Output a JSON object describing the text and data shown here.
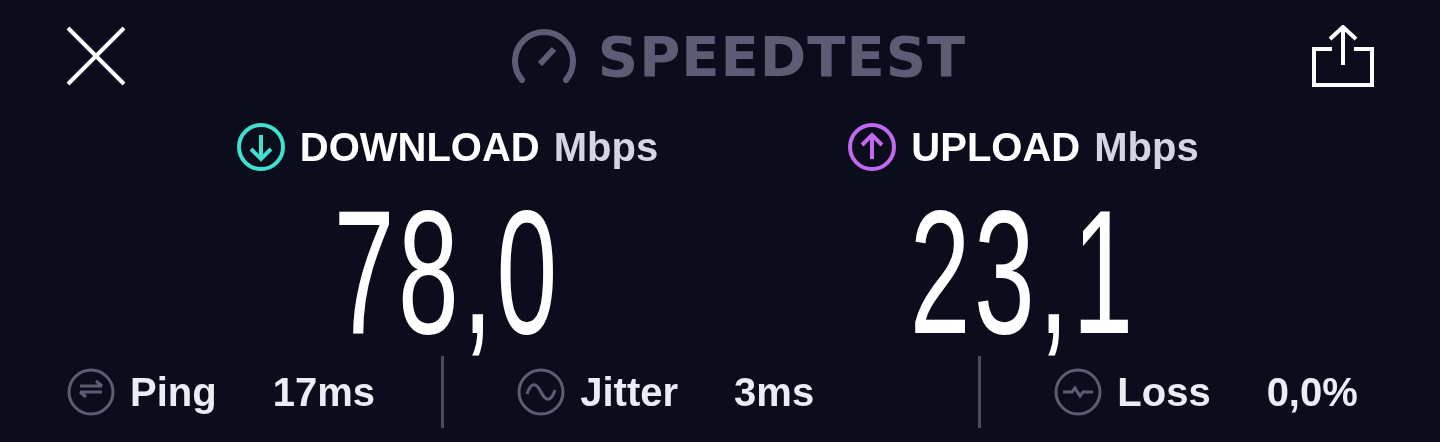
{
  "header": {
    "title": "SPEEDTEST"
  },
  "results": [
    {
      "kind": "download",
      "label": "DOWNLOAD",
      "unit": "Mbps",
      "value": "78,0",
      "color": "#3fe0d0"
    },
    {
      "kind": "upload",
      "label": "UPLOAD",
      "unit": "Mbps",
      "value": "23,1",
      "color": "#c169f0"
    }
  ],
  "stats": [
    {
      "kind": "ping",
      "label": "Ping",
      "value": "17ms"
    },
    {
      "kind": "jitter",
      "label": "Jitter",
      "value": "3ms"
    },
    {
      "kind": "loss",
      "label": "Loss",
      "value": "0,0%"
    }
  ]
}
